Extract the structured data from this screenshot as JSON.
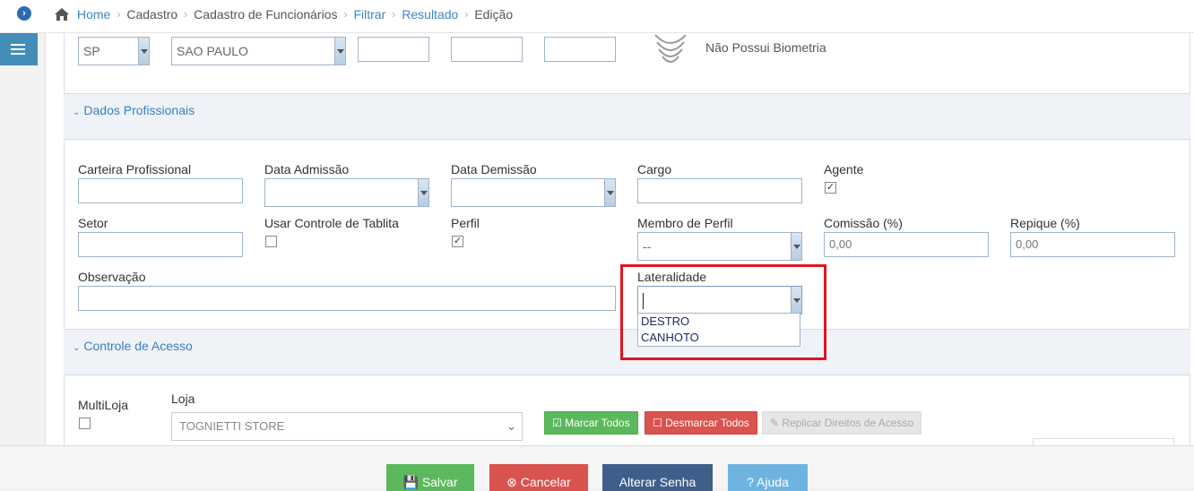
{
  "breadcrumb": {
    "home": "Home",
    "items": [
      "Cadastro",
      "Cadastro de Funcionários"
    ],
    "links": [
      "Filtrar",
      "Resultado"
    ],
    "current": "Edição"
  },
  "address": {
    "state": "SP",
    "city": "SAO PAULO",
    "biometry_status": "Não Possui Biometria"
  },
  "sections": {
    "professional": "Dados Profissionais",
    "access": "Controle de Acesso"
  },
  "professional": {
    "carteira_label": "Carteira Profissional",
    "admissao_label": "Data Admissão",
    "demissao_label": "Data Demissão",
    "cargo_label": "Cargo",
    "agente_label": "Agente",
    "setor_label": "Setor",
    "tablita_label": "Usar Controle de Tablita",
    "perfil_label": "Perfil",
    "membro_label": "Membro de Perfil",
    "membro_value": "--",
    "comissao_label": "Comissão (%)",
    "comissao_value": "0,00",
    "repique_label": "Repique (%)",
    "repique_value": "0,00",
    "observacao_label": "Observação",
    "lateralidade_label": "Lateralidade",
    "lateralidade_options": [
      "DESTRO",
      "CANHOTO"
    ]
  },
  "access": {
    "multiloja_label": "MultiLoja",
    "loja_label": "Loja",
    "loja_value": "TOGNIETTI STORE",
    "marcar": "Marcar Todos",
    "desmarcar": "Desmarcar Todos",
    "replicar": "Replicar Direitos de Acesso"
  },
  "footer": {
    "salvar": "Salvar",
    "cancelar": "Cancelar",
    "alterar": "Alterar Senha",
    "ajuda": "Ajuda"
  },
  "colors": {
    "link": "#3c86c5",
    "highlight": "#e0141e",
    "green": "#5cb85c",
    "red": "#d9534f",
    "navy": "#3e5f8a",
    "light_blue": "#6fb3e0"
  }
}
